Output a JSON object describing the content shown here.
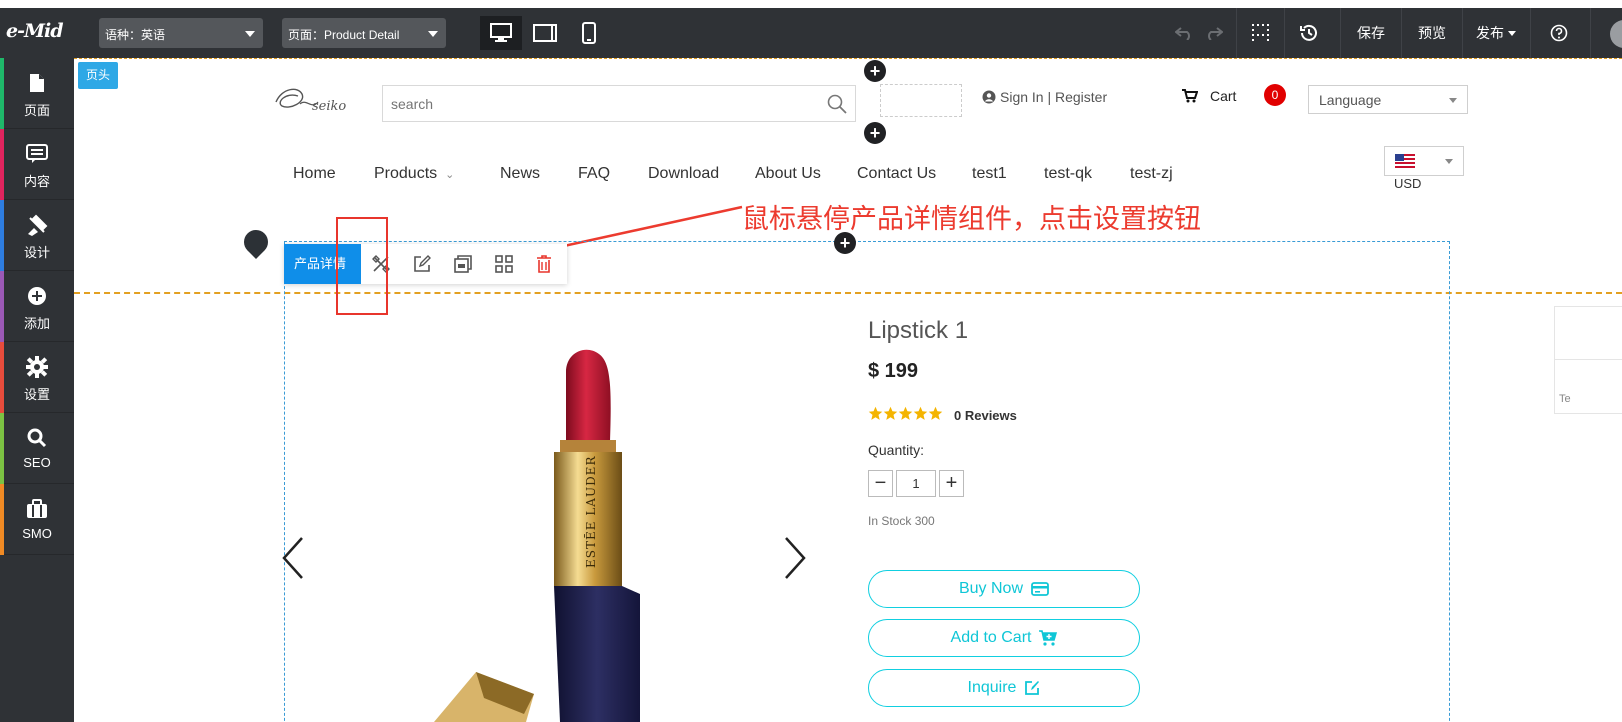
{
  "topbar": {
    "logo_text": "e-Mid",
    "language_select": "语种：英语",
    "page_select": "页面：Product Detail",
    "save": "保存",
    "preview": "预览",
    "publish": "发布"
  },
  "sidebar": {
    "items": [
      {
        "label": "页面",
        "icon": "file-icon",
        "color": "#1fb86a"
      },
      {
        "label": "内容",
        "icon": "content-icon",
        "color": "#e0245e"
      },
      {
        "label": "设计",
        "icon": "design-icon",
        "color": "#2e7de0"
      },
      {
        "label": "添加",
        "icon": "add-icon",
        "color": "#9b59b6"
      },
      {
        "label": "设置",
        "icon": "gear-icon",
        "color": "#e74c3c"
      },
      {
        "label": "SEO",
        "icon": "search-icon",
        "color": "#7cc243"
      },
      {
        "label": "SMO",
        "icon": "briefcase-icon",
        "color": "#f08a24"
      }
    ]
  },
  "header_zone": {
    "tag": "页头",
    "search_placeholder": "search",
    "sign_in": "Sign In | Register",
    "cart_label": "Cart",
    "cart_count": "0",
    "language": "Language",
    "currency": "USD",
    "nav": [
      "Home",
      "Products",
      "News",
      "FAQ",
      "Download",
      "About Us",
      "Contact Us",
      "test1",
      "test-qk",
      "test-zj"
    ]
  },
  "annotation": "鼠标悬停产品详情组件，点击设置按钮",
  "component_toolbar": {
    "name": "产品详情",
    "tools": [
      "settings-icon",
      "edit-icon",
      "copy-icon",
      "grid-icon",
      "delete-icon"
    ]
  },
  "product": {
    "name": "Lipstick 1",
    "price": "$ 199",
    "rating_stars": 5,
    "reviews": "0 Reviews",
    "quantity_label": "Quantity:",
    "quantity": "1",
    "stock": "In Stock 300",
    "buy_now": "Buy Now",
    "add_to_cart": "Add to Cart",
    "inquire": "Inquire",
    "brand_on_image": "ESTĒE LAUDER"
  },
  "right_fragment_text": "Te",
  "colors": {
    "accent_blue": "#0f8ee9",
    "annotation_red": "#ec3b2f",
    "button_cyan": "#11cfe0",
    "header_dash": "#e3a021"
  }
}
